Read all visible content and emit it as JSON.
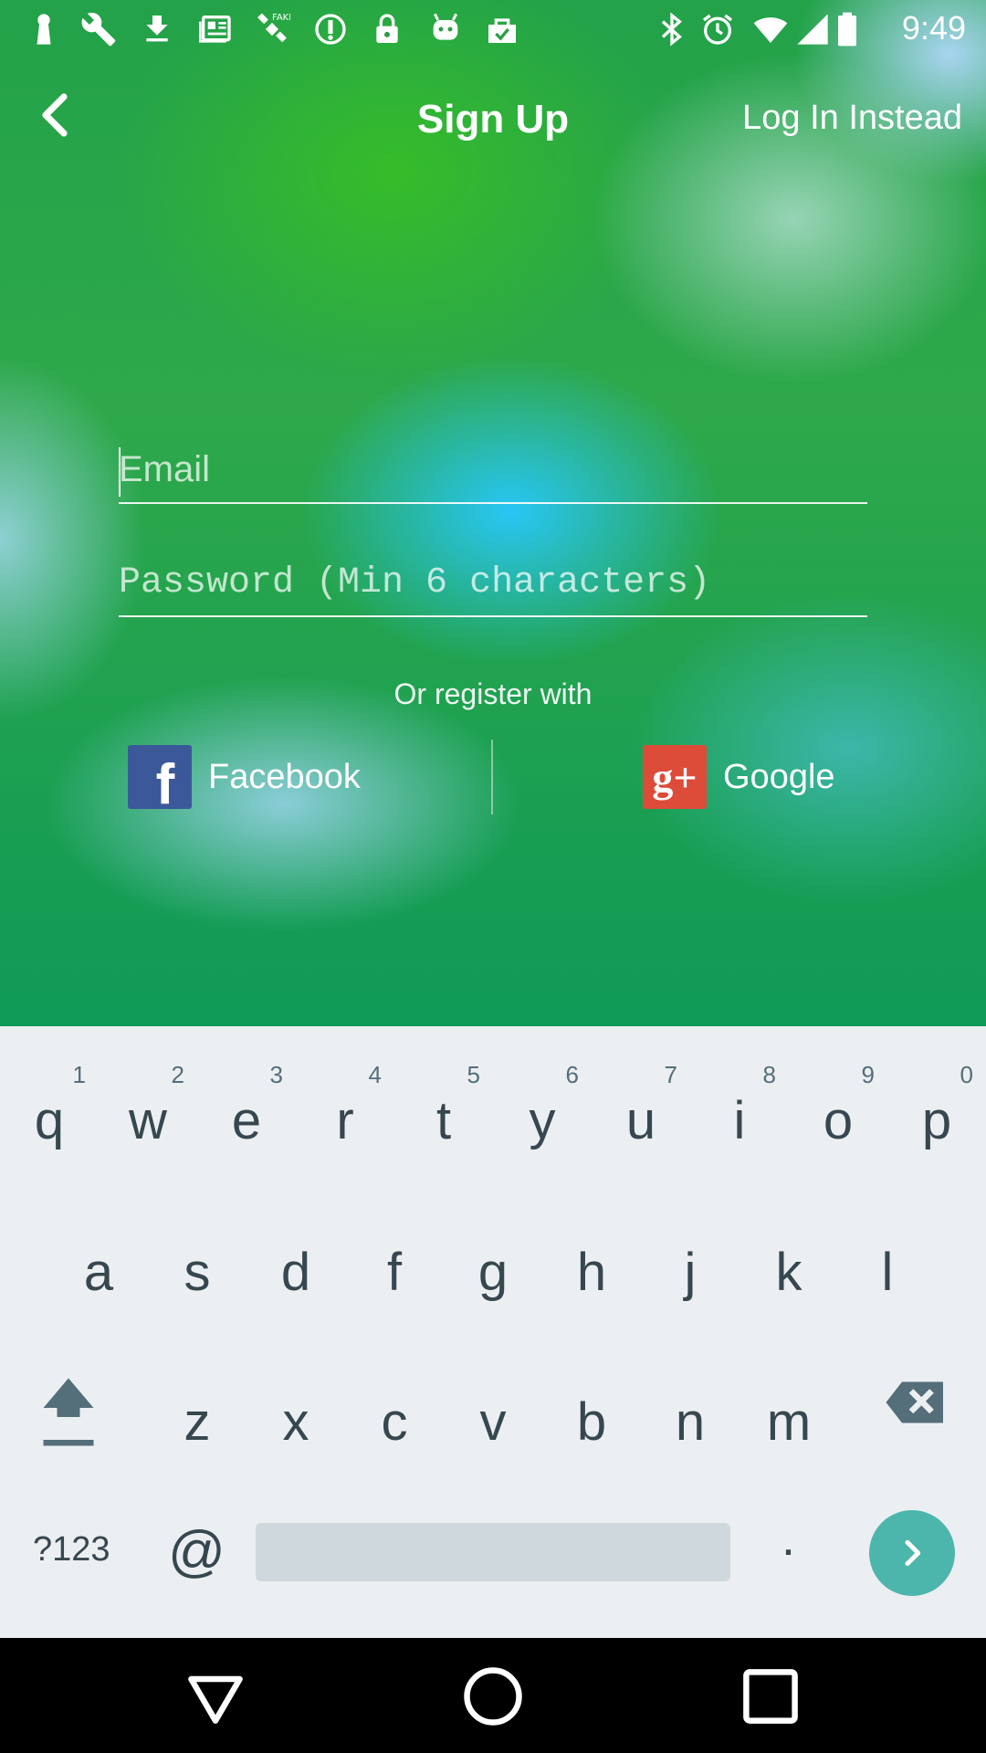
{
  "status_bar": {
    "time": "9:49",
    "icons_left": [
      "keyhole-icon",
      "wrench-icon",
      "download-icon",
      "news-icon",
      "satellite-icon",
      "info-icon",
      "lock-icon",
      "android-icon",
      "task-icon"
    ],
    "icons_right": [
      "bluetooth-icon",
      "alarm-icon"
    ]
  },
  "header": {
    "title": "Sign Up",
    "login_link": "Log In Instead"
  },
  "form": {
    "email_placeholder": "Email",
    "email_value": "",
    "password_placeholder": "Password (Min 6 characters)",
    "password_value": ""
  },
  "social": {
    "or_text": "Or register with",
    "facebook_label": "Facebook",
    "facebook_glyph": "f",
    "google_label": "Google",
    "google_glyph": "g+"
  },
  "keyboard": {
    "row1": [
      {
        "k": "q",
        "h": "1"
      },
      {
        "k": "w",
        "h": "2"
      },
      {
        "k": "e",
        "h": "3"
      },
      {
        "k": "r",
        "h": "4"
      },
      {
        "k": "t",
        "h": "5"
      },
      {
        "k": "y",
        "h": "6"
      },
      {
        "k": "u",
        "h": "7"
      },
      {
        "k": "i",
        "h": "8"
      },
      {
        "k": "o",
        "h": "9"
      },
      {
        "k": "p",
        "h": "0"
      }
    ],
    "row2": [
      "a",
      "s",
      "d",
      "f",
      "g",
      "h",
      "j",
      "k",
      "l"
    ],
    "row3": [
      "z",
      "x",
      "c",
      "v",
      "b",
      "n",
      "m"
    ],
    "symbols_label": "?123",
    "at_label": "@",
    "period_label": "."
  },
  "colors": {
    "keyboard_bg": "#eceff1",
    "enter_key": "#4db6ac",
    "facebook": "#3b5998",
    "google": "#dd4b39"
  }
}
